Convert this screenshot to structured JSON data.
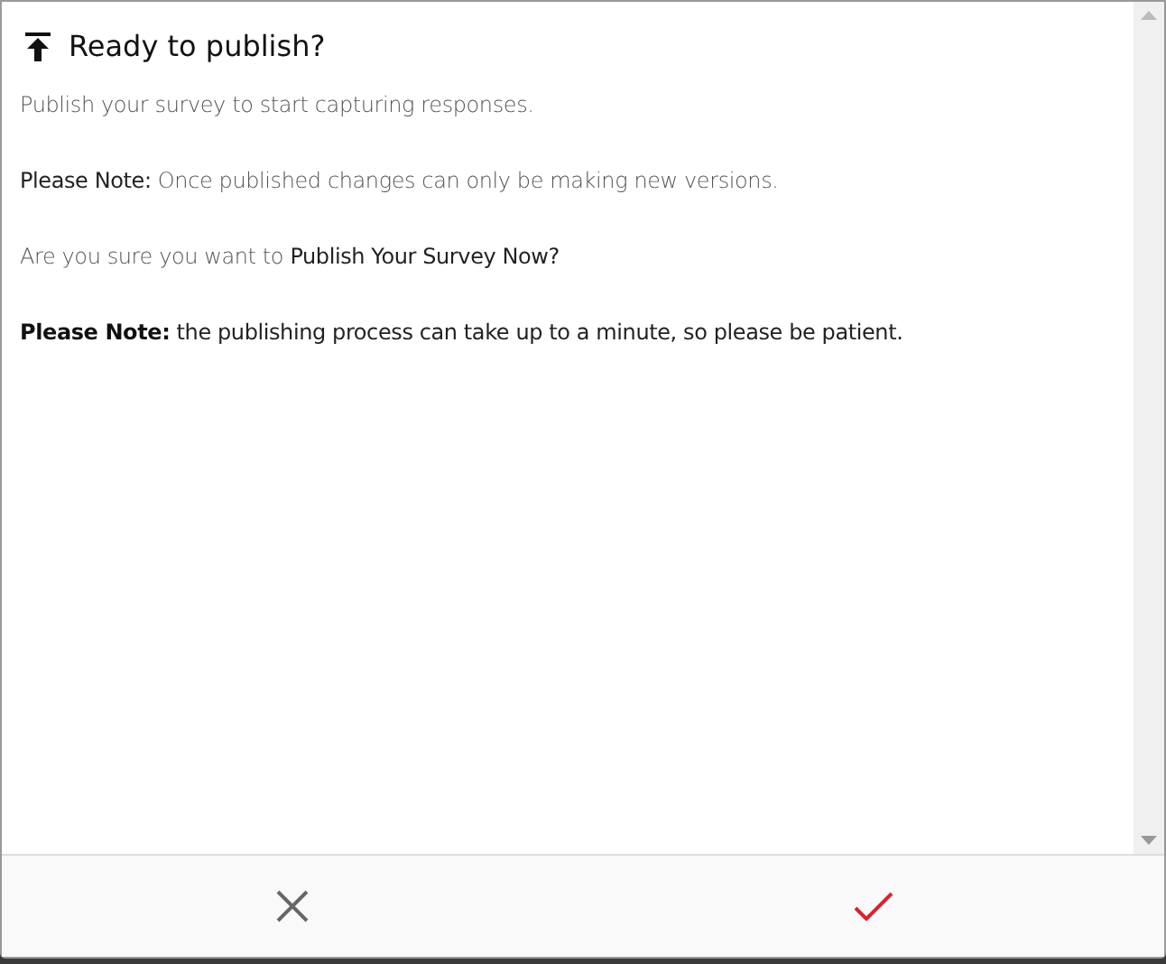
{
  "dialog": {
    "title": "Ready to publish?",
    "paragraphs": [
      [
        {
          "text": "Publish your survey to start capturing responses.",
          "kind": "plain"
        }
      ],
      [
        {
          "text": "Please Note:",
          "kind": "emphasis"
        },
        {
          "text": " Once published changes can only be making new versions.",
          "kind": "plain"
        }
      ],
      [
        {
          "text": "Are you sure you want to ",
          "kind": "plain"
        },
        {
          "text": "Publish Your Survey Now?",
          "kind": "emphasis"
        }
      ],
      [
        {
          "text": "Please Note:",
          "kind": "strong"
        },
        {
          "text": " the publishing process can take up to a minute, so please be patient.",
          "kind": "emphasis"
        }
      ]
    ],
    "buttons": [
      {
        "kind": "cancel"
      },
      {
        "kind": "confirm"
      }
    ]
  }
}
